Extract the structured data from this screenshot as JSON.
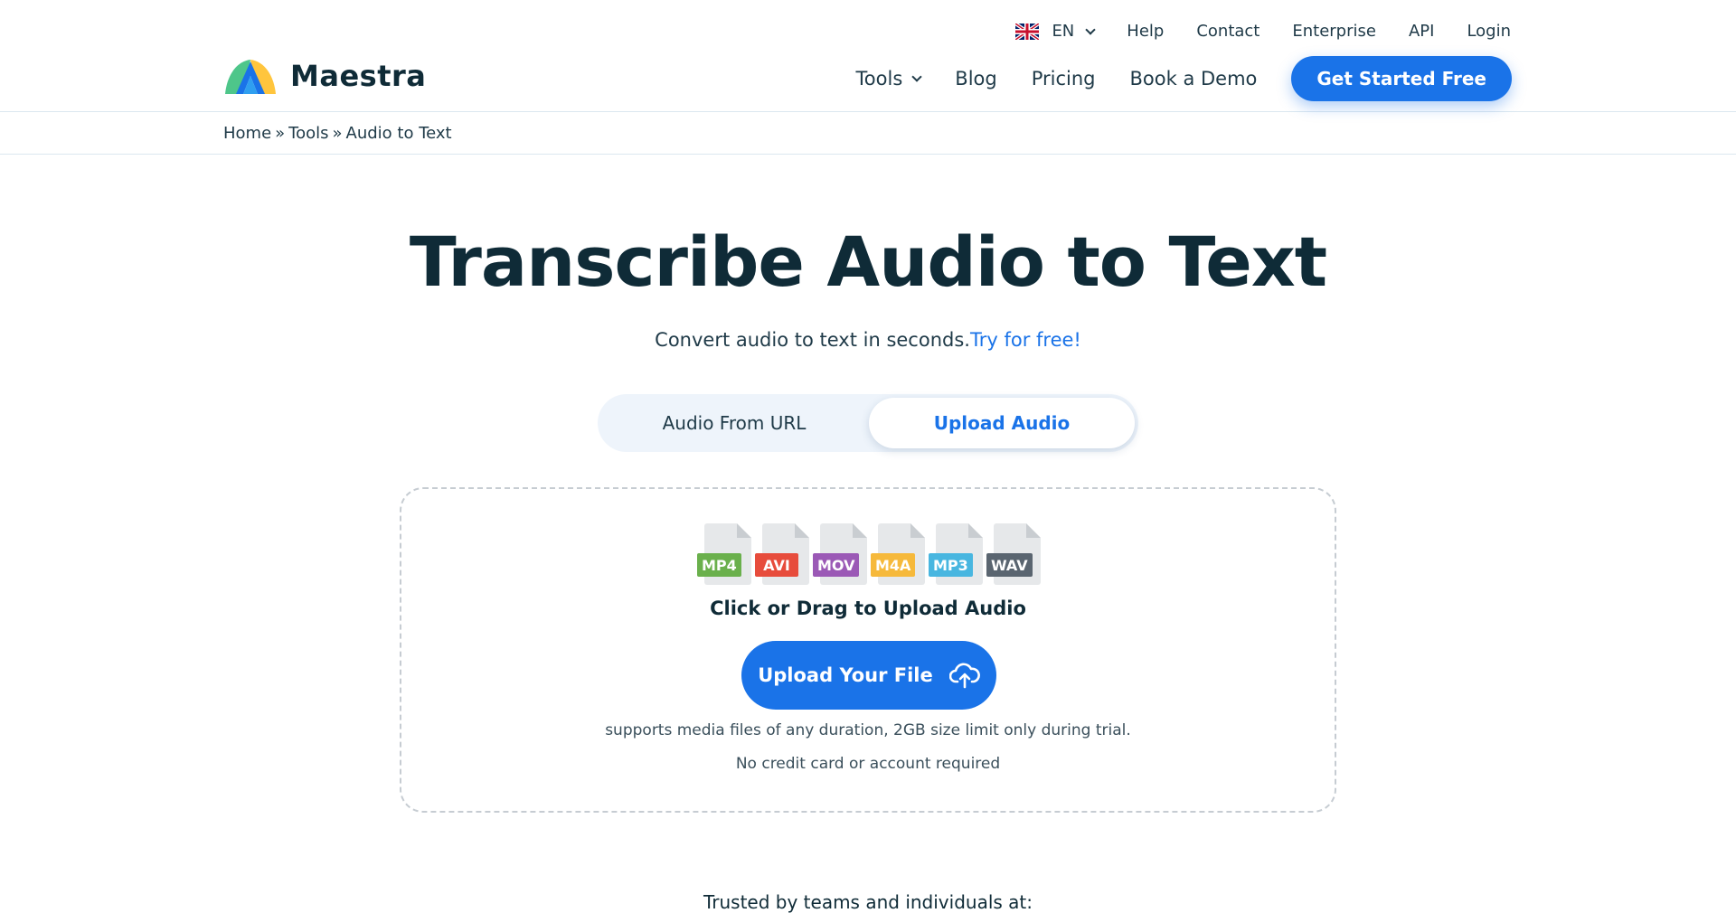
{
  "brand": {
    "name": "Maestra"
  },
  "top_nav": {
    "language": "EN",
    "items": [
      "Help",
      "Contact",
      "Enterprise",
      "API",
      "Login"
    ]
  },
  "main_nav": {
    "items": [
      "Tools",
      "Blog",
      "Pricing",
      "Book a Demo"
    ],
    "cta": "Get Started Free"
  },
  "breadcrumb": {
    "items": [
      "Home",
      "Tools",
      "Audio to Text"
    ],
    "separator": "»"
  },
  "hero": {
    "title": "Transcribe Audio to Text",
    "subtitle": "Convert audio to text in seconds.",
    "subtitle_link": "Try for free!"
  },
  "tabs": [
    {
      "label": "Audio From URL",
      "active": false
    },
    {
      "label": "Upload Audio",
      "active": true
    }
  ],
  "upload": {
    "formats": [
      {
        "label": "MP4",
        "color": "#6ab04c"
      },
      {
        "label": "AVI",
        "color": "#e74c3c"
      },
      {
        "label": "MOV",
        "color": "#9b59b6"
      },
      {
        "label": "M4A",
        "color": "#f6b93b"
      },
      {
        "label": "MP3",
        "color": "#48b6e0"
      },
      {
        "label": "WAV",
        "color": "#5a6570"
      }
    ],
    "title": "Click or Drag to Upload Audio",
    "button": "Upload Your File",
    "note_1": "supports media files of any duration, 2GB size limit only during trial.",
    "note_2": "No credit card or account required"
  },
  "trusted": "Trusted by teams and individuals at:",
  "colors": {
    "accent": "#1a73e8",
    "text": "#0f2b37",
    "tab_bg": "#eef4fb"
  },
  "icons": [
    "maestra-logo-icon",
    "uk-flag-icon",
    "chevron-down-icon",
    "cloud-upload-icon",
    "file-icon"
  ]
}
